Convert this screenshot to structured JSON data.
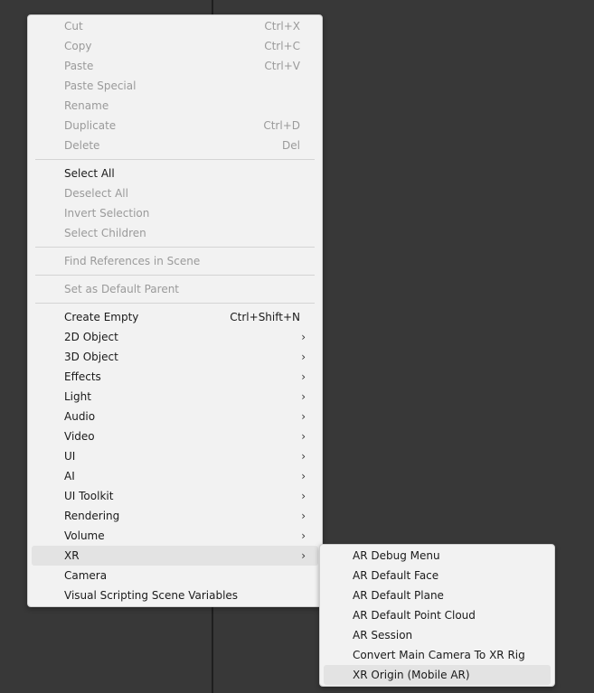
{
  "main_menu": {
    "group1": [
      {
        "label": "Cut",
        "shortcut": "Ctrl+X",
        "enabled": false
      },
      {
        "label": "Copy",
        "shortcut": "Ctrl+C",
        "enabled": false
      },
      {
        "label": "Paste",
        "shortcut": "Ctrl+V",
        "enabled": false
      },
      {
        "label": "Paste Special",
        "shortcut": "",
        "enabled": false
      },
      {
        "label": "Rename",
        "shortcut": "",
        "enabled": false
      },
      {
        "label": "Duplicate",
        "shortcut": "Ctrl+D",
        "enabled": false
      },
      {
        "label": "Delete",
        "shortcut": "Del",
        "enabled": false
      }
    ],
    "group2": [
      {
        "label": "Select All",
        "enabled": true
      },
      {
        "label": "Deselect All",
        "enabled": false
      },
      {
        "label": "Invert Selection",
        "enabled": false
      },
      {
        "label": "Select Children",
        "enabled": false
      }
    ],
    "group3": [
      {
        "label": "Find References in Scene",
        "enabled": false
      }
    ],
    "group4": [
      {
        "label": "Set as Default Parent",
        "enabled": false
      }
    ],
    "group5": [
      {
        "label": "Create Empty",
        "shortcut": "Ctrl+Shift+N"
      },
      {
        "label": "2D Object",
        "submenu": true
      },
      {
        "label": "3D Object",
        "submenu": true
      },
      {
        "label": "Effects",
        "submenu": true
      },
      {
        "label": "Light",
        "submenu": true
      },
      {
        "label": "Audio",
        "submenu": true
      },
      {
        "label": "Video",
        "submenu": true
      },
      {
        "label": "UI",
        "submenu": true
      },
      {
        "label": "AI",
        "submenu": true
      },
      {
        "label": "UI Toolkit",
        "submenu": true
      },
      {
        "label": "Rendering",
        "submenu": true
      },
      {
        "label": "Volume",
        "submenu": true
      },
      {
        "label": "XR",
        "submenu": true
      },
      {
        "label": "Camera"
      },
      {
        "label": "Visual Scripting Scene Variables"
      }
    ]
  },
  "xr_submenu": [
    {
      "label": "AR Debug Menu"
    },
    {
      "label": "AR Default Face"
    },
    {
      "label": "AR Default Plane"
    },
    {
      "label": "AR Default Point Cloud"
    },
    {
      "label": "AR Session"
    },
    {
      "label": "Convert Main Camera To XR Rig"
    },
    {
      "label": "XR Origin (Mobile AR)"
    }
  ],
  "icons": {
    "submenu_arrow": "chevron-right-icon",
    "arrow_glyph": "›"
  },
  "colors": {
    "background": "#383838",
    "menu_bg": "#f2f2f2",
    "disabled_text": "#9a9a9a",
    "highlight": "#e3e3e3"
  }
}
